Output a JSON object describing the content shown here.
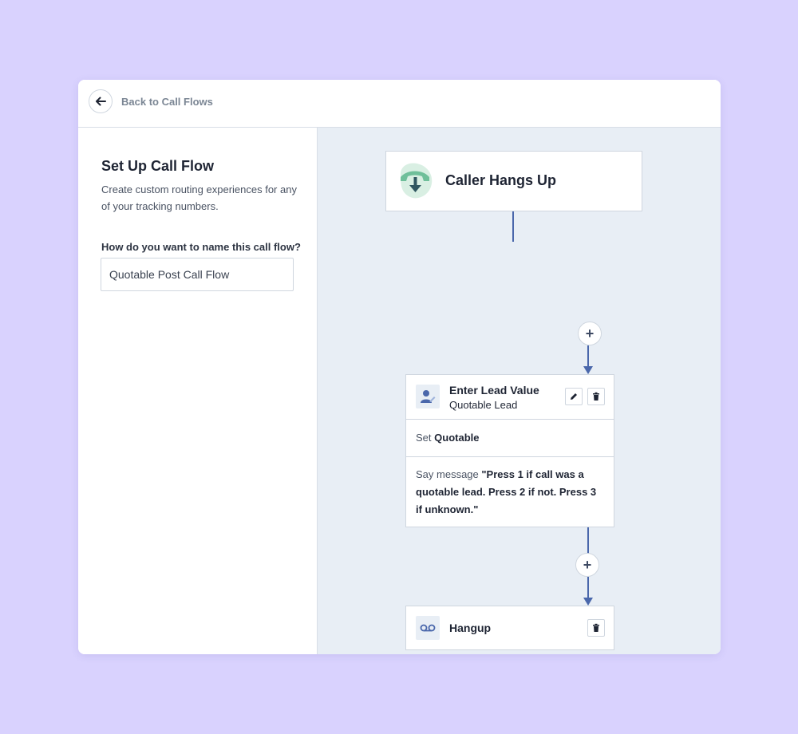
{
  "header": {
    "back_label": "Back to Call Flows"
  },
  "left": {
    "title": "Set Up Call Flow",
    "description": "Create custom routing experiences for any of your tracking numbers.",
    "field_label": "How do you want to name this call flow?",
    "name_value": "Quotable Post Call Flow"
  },
  "flow": {
    "start": {
      "title": "Caller Hangs Up",
      "icon": "phone-hangup-icon"
    },
    "add_label": "+",
    "step1": {
      "title": "Enter Lead Value",
      "subtitle": "Quotable Lead",
      "icon": "user-edit-icon",
      "row1_prefix": "Set",
      "row1_value": "Quotable",
      "row2_prefix": "Say message",
      "row2_value": "\"Press 1 if call was a quotable lead. Press 2 if not. Press 3 if unknown.\""
    },
    "step2": {
      "title": "Hangup",
      "icon": "voicemail-icon"
    }
  },
  "colors": {
    "background": "#d9d2fe",
    "canvas": "#e8eef5",
    "connector": "#4a67ab",
    "start_icon": "#6fbf9a"
  }
}
